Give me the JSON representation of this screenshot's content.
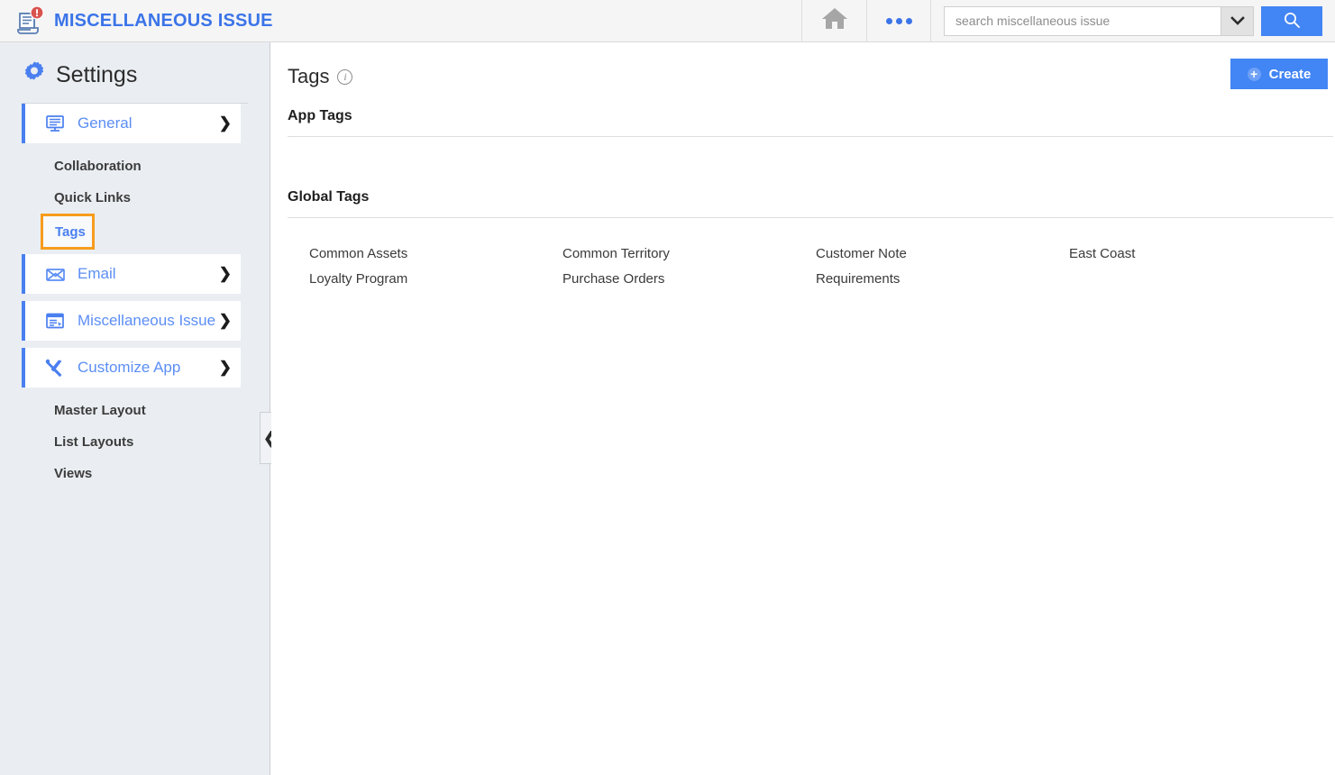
{
  "topbar": {
    "app_title": "MISCELLANEOUS ISSUE",
    "logo_icon": "document-alert-icon",
    "badge_icon": "alert-badge-icon",
    "home_icon": "home-icon",
    "more_icon": "more-dots-icon",
    "search": {
      "placeholder": "search miscellaneous issue",
      "value": "",
      "dropdown_icon": "chevron-down-icon",
      "button_icon": "search-icon"
    }
  },
  "sidebar": {
    "title": "Settings",
    "title_icon": "gear-icon",
    "collapse_icon": "chevron-left-icon",
    "items": [
      {
        "label": "General",
        "icon": "monitor-icon",
        "chevron": "chevron-right-icon",
        "type": "parent"
      },
      {
        "label": "Collaboration",
        "type": "child"
      },
      {
        "label": "Quick Links",
        "type": "child"
      },
      {
        "label": "Tags",
        "type": "child",
        "selected": true
      },
      {
        "label": "Email",
        "icon": "envelope-icon",
        "chevron": "chevron-right-icon",
        "type": "parent"
      },
      {
        "label": "Miscellaneous Issue",
        "icon": "window-list-icon",
        "chevron": "chevron-right-icon",
        "type": "parent"
      },
      {
        "label": "Customize App",
        "icon": "tools-icon",
        "chevron": "chevron-down-icon",
        "type": "parent"
      },
      {
        "label": "Master Layout",
        "type": "child"
      },
      {
        "label": "List Layouts",
        "type": "child"
      },
      {
        "label": "Views",
        "type": "child"
      }
    ]
  },
  "main": {
    "page_title": "Tags",
    "info_icon": "info-icon",
    "create_label": "Create",
    "create_icon": "plus-circle-icon",
    "app_tags": {
      "heading": "App Tags",
      "tags": []
    },
    "global_tags": {
      "heading": "Global Tags",
      "tags": [
        "Common Assets",
        "Common Territory",
        "Customer Note",
        "East Coast",
        "Loyalty Program",
        "Purchase Orders",
        "Requirements"
      ]
    }
  },
  "colors": {
    "brand_blue": "#3b74e8",
    "accent_blue": "#4285f4",
    "link_blue": "#5c8ef5",
    "highlight_orange": "#f79c1d",
    "sidebar_bg": "#eaeef2",
    "topbar_bg": "#f5f5f5",
    "alert_red": "#d9534f"
  }
}
